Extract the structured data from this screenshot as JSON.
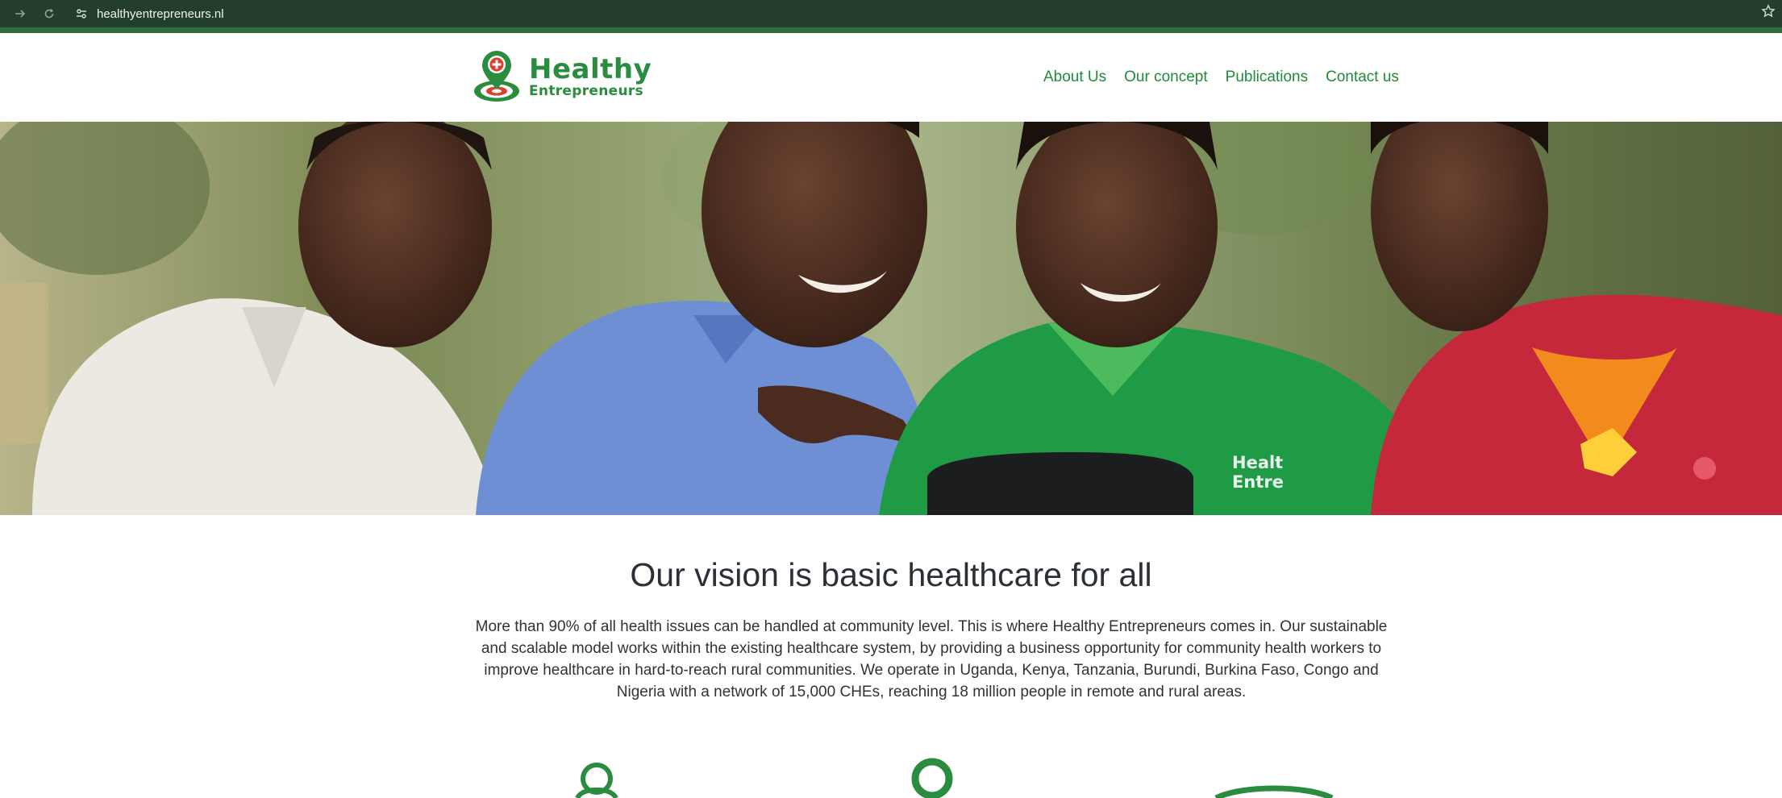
{
  "browser": {
    "url": "healthyentrepreneurs.nl",
    "forward_icon": "arrow-right-icon",
    "reload_icon": "reload-icon",
    "site_settings_icon": "tune-icon",
    "bookmark_icon": "star-icon"
  },
  "header": {
    "logo_title": "Healthy",
    "logo_subtitle": "Entrepreneurs",
    "nav": [
      {
        "label": "About Us"
      },
      {
        "label": "Our concept"
      },
      {
        "label": "Publications"
      },
      {
        "label": "Contact us"
      }
    ]
  },
  "hero": {
    "shirt_logo_line1": "Healt",
    "shirt_logo_line2": "Entre"
  },
  "vision": {
    "title": "Our vision is basic healthcare for all",
    "body": "More than 90% of all health issues can be handled at community level. This is where Healthy Entrepreneurs comes in. Our sustainable and scalable model works within the existing healthcare system, by providing a business opportunity for community health workers to improve healthcare in hard-to-reach rural communities. We operate in Uganda, Kenya, Tanzania, Burundi, Burkina Faso, Congo and Nigeria with a network of 15,000 CHEs, reaching 18 million people in remote and rural areas."
  },
  "colors": {
    "brand_green": "#2a8c3e",
    "chrome_dark": "#233f2c",
    "logo_red": "#d8412f"
  },
  "features": [
    {
      "icon": "person-icon"
    },
    {
      "icon": "person-icon"
    },
    {
      "icon": "circle-icon"
    }
  ]
}
